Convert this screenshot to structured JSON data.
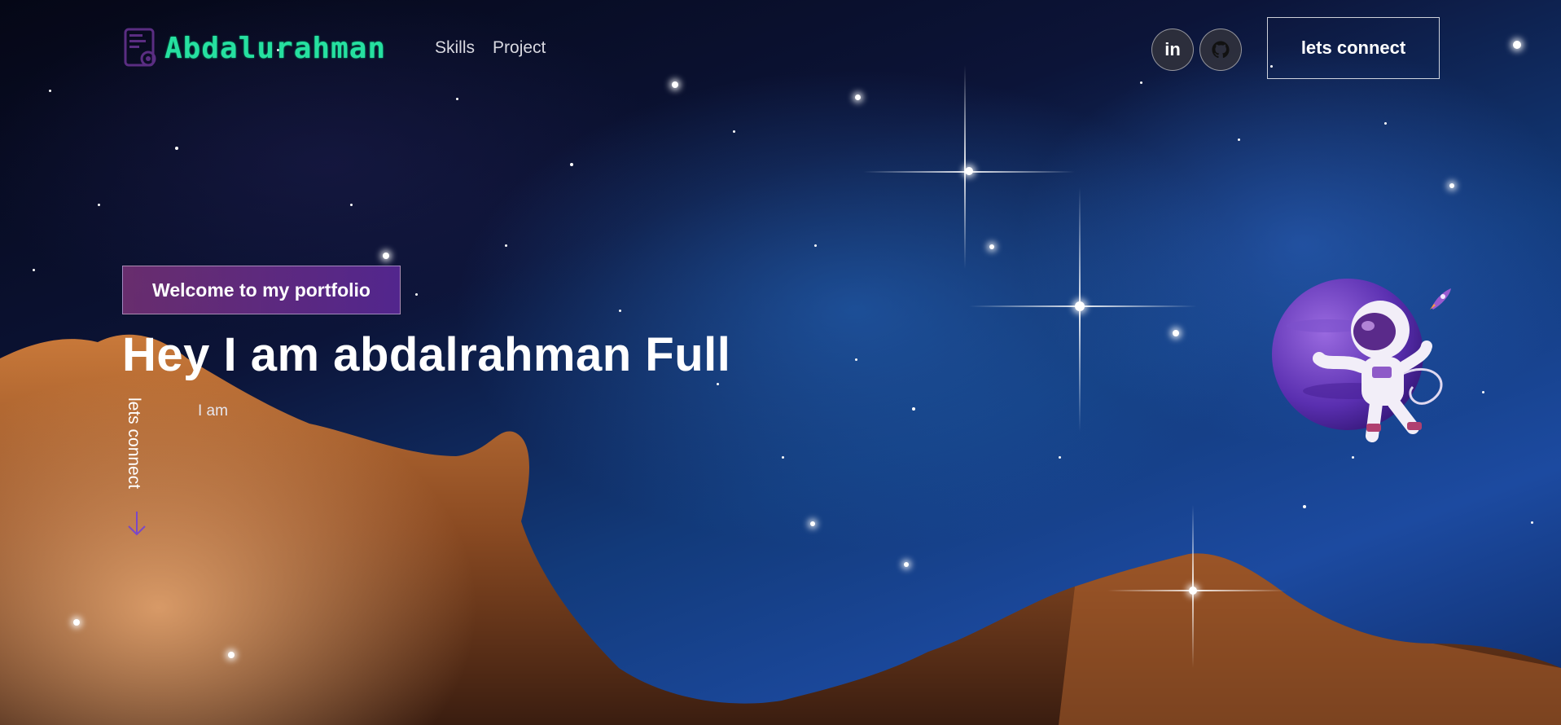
{
  "header": {
    "logo_text": "Abdalurahman",
    "logo_icon": "code-monitor-icon",
    "nav": [
      {
        "label": "Skills"
      },
      {
        "label": "Project"
      }
    ],
    "social": [
      {
        "icon": "linkedin-icon",
        "text": "in"
      },
      {
        "icon": "github-icon"
      }
    ],
    "connect_label": "lets connect"
  },
  "hero": {
    "tagline": "Welcome to my portfolio",
    "headline": "Hey I am abdalrahman Full",
    "subline": "I am",
    "vertical_cta": "lets connect",
    "vertical_icon": "arrow-down-icon",
    "illustration": "astronaut-planet-icon",
    "decoration": "rocket-icon"
  },
  "colors": {
    "logo": "#26e0a0",
    "accent_purple": "#6a35b0",
    "tagline_start": "#7a3278",
    "tagline_end": "#5a2896"
  }
}
